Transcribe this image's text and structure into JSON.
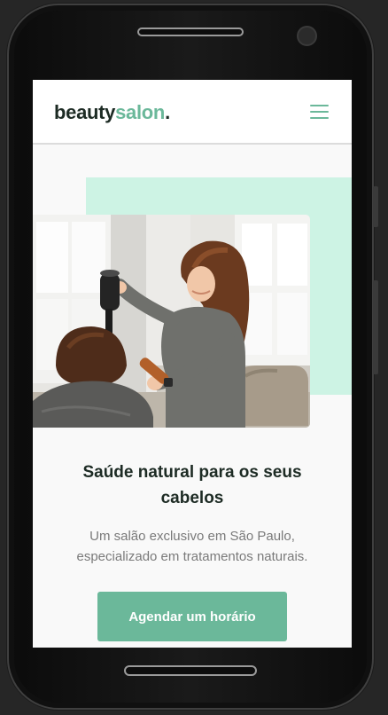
{
  "header": {
    "logo_part1": "beauty",
    "logo_part2": "salon",
    "logo_part3": ".",
    "menu_icon": "hamburger-menu-icon"
  },
  "hero": {
    "image_icon": "salon-photo",
    "headline": "Saúde natural para os seus cabelos",
    "subtext": "Um salão exclusivo em São Paulo, especializado em tratamentos naturais.",
    "cta_label": "Agendar um horário"
  },
  "colors": {
    "accent": "#6bb89a",
    "mint": "#cdf3e4",
    "text_dark": "#1d2b24",
    "text_muted": "#7a7a7a",
    "background": "#f9f9f9"
  }
}
